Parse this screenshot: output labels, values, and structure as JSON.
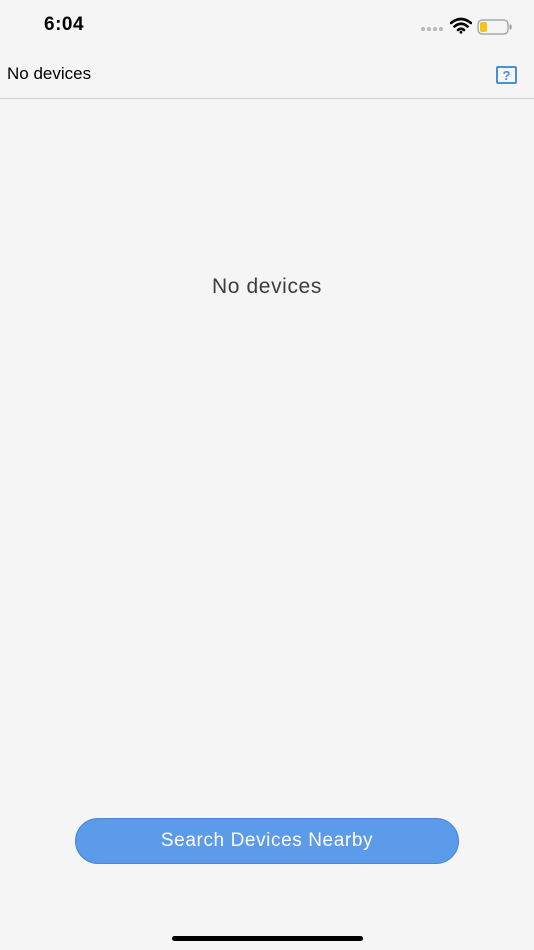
{
  "status_bar": {
    "time": "6:04",
    "battery_level": 0.25,
    "battery_color": "#f5c518"
  },
  "nav_bar": {
    "title": "No devices",
    "help_label": "?",
    "accent_color": "#4a90d9"
  },
  "main": {
    "empty_message": "No devices"
  },
  "footer": {
    "search_button_label": "Search Devices Nearby",
    "button_color": "#5b9bea"
  }
}
